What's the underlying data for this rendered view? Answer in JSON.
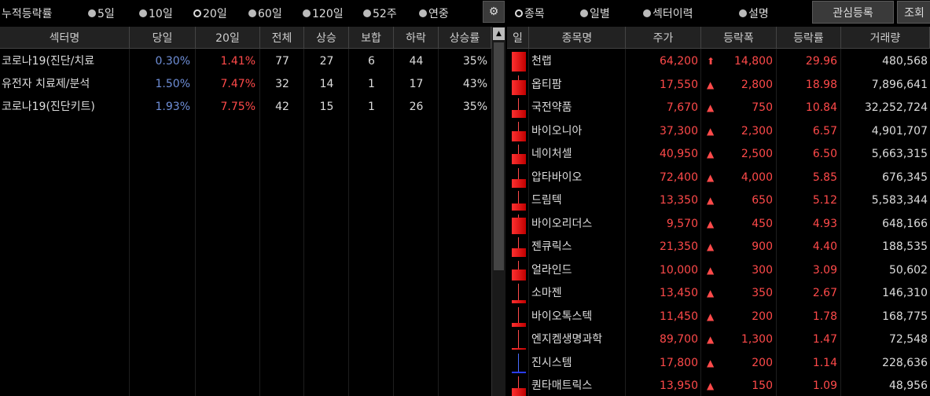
{
  "toolbar": {
    "title": "누적등락률",
    "radios": [
      {
        "label": "5일",
        "selected": false
      },
      {
        "label": "10일",
        "selected": false
      },
      {
        "label": "20일",
        "selected": true
      },
      {
        "label": "60일",
        "selected": false
      },
      {
        "label": "120일",
        "selected": false
      },
      {
        "label": "52주",
        "selected": false
      },
      {
        "label": "연중",
        "selected": false
      }
    ],
    "gear": "⚙",
    "view_radios": [
      {
        "label": "종목",
        "selected": true
      },
      {
        "label": "일별",
        "selected": false
      },
      {
        "label": "섹터이력",
        "selected": false
      },
      {
        "label": "설명",
        "selected": false
      }
    ],
    "watch_button": "관심등록",
    "query_button": "조회"
  },
  "sector_table": {
    "headers": [
      "섹터명",
      "당일",
      "20일",
      "전체",
      "상승",
      "보합",
      "하락",
      "상승률"
    ],
    "rows": [
      {
        "name": "코로나19(진단/치료",
        "today": "0.30%",
        "d20": "1.41%",
        "total": "77",
        "up": "27",
        "flat": "6",
        "down": "44",
        "up_rate": "35%"
      },
      {
        "name": "유전자 치료제/분석",
        "today": "1.50%",
        "d20": "7.47%",
        "total": "32",
        "up": "14",
        "flat": "1",
        "down": "17",
        "up_rate": "43%"
      },
      {
        "name": "코로나19(진단키트)",
        "today": "1.93%",
        "d20": "7.75%",
        "total": "42",
        "up": "15",
        "flat": "1",
        "down": "26",
        "up_rate": "35%"
      }
    ]
  },
  "stock_table": {
    "headers": [
      "일",
      "종목명",
      "주가",
      "등락폭",
      "등락률",
      "거래량"
    ],
    "rows": [
      {
        "name": "천랩",
        "price": "64,200",
        "arrow": "⬆",
        "change": "14,800",
        "rate": "29.96",
        "volume": "480,568",
        "candle": 1.0
      },
      {
        "name": "옵티팜",
        "price": "17,550",
        "arrow": "▲",
        "change": "2,800",
        "rate": "18.98",
        "volume": "7,896,641",
        "candle": 0.75
      },
      {
        "name": "국전약품",
        "price": "7,670",
        "arrow": "▲",
        "change": "750",
        "rate": "10.84",
        "volume": "32,252,724",
        "candle": 0.4
      },
      {
        "name": "바이오니아",
        "price": "37,300",
        "arrow": "▲",
        "change": "2,300",
        "rate": "6.57",
        "volume": "4,901,707",
        "candle": 0.5
      },
      {
        "name": "네이처셀",
        "price": "40,950",
        "arrow": "▲",
        "change": "2,500",
        "rate": "6.50",
        "volume": "5,663,315",
        "candle": 0.5
      },
      {
        "name": "압타바이오",
        "price": "72,400",
        "arrow": "▲",
        "change": "4,000",
        "rate": "5.85",
        "volume": "676,345",
        "candle": 0.45
      },
      {
        "name": "드림텍",
        "price": "13,350",
        "arrow": "▲",
        "change": "650",
        "rate": "5.12",
        "volume": "5,583,344",
        "candle": 0.35
      },
      {
        "name": "바이오리더스",
        "price": "9,570",
        "arrow": "▲",
        "change": "450",
        "rate": "4.93",
        "volume": "648,166",
        "candle": 0.85
      },
      {
        "name": "젠큐릭스",
        "price": "21,350",
        "arrow": "▲",
        "change": "900",
        "rate": "4.40",
        "volume": "188,535",
        "candle": 0.45
      },
      {
        "name": "얼라인드",
        "price": "10,000",
        "arrow": "▲",
        "change": "300",
        "rate": "3.09",
        "volume": "50,602",
        "candle": 0.55
      },
      {
        "name": "소마젠",
        "price": "13,450",
        "arrow": "▲",
        "change": "350",
        "rate": "2.67",
        "volume": "146,310",
        "candle": 0.15
      },
      {
        "name": "바이오톡스텍",
        "price": "11,450",
        "arrow": "▲",
        "change": "200",
        "rate": "1.78",
        "volume": "168,775",
        "candle": 0.2
      },
      {
        "name": "엔지켐생명과학",
        "price": "89,700",
        "arrow": "▲",
        "change": "1,300",
        "rate": "1.47",
        "volume": "72,548",
        "candle": 0.05
      },
      {
        "name": "진시스템",
        "price": "17,800",
        "arrow": "▲",
        "change": "200",
        "rate": "1.14",
        "volume": "228,636",
        "candle": -0.05
      },
      {
        "name": "퀀타매트릭스",
        "price": "13,950",
        "arrow": "▲",
        "change": "150",
        "rate": "1.09",
        "volume": "48,956",
        "candle": 0.4
      }
    ]
  }
}
